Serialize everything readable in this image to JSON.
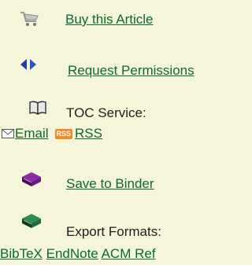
{
  "links": {
    "buy_article": "Buy this Article",
    "request_permissions": "Request Permissions",
    "save_to_binder": "Save to Binder"
  },
  "toc": {
    "heading": "TOC Service:",
    "email": "Email",
    "rss_badge": "RSS",
    "rss": "RSS"
  },
  "export": {
    "heading": "Export Formats:",
    "bibtex": "BibTeX",
    "endnote": "EndNote",
    "acm_ref": "ACM Ref"
  },
  "icons": {
    "buy": "cart-icon",
    "permissions": "permissions-arrows-icon",
    "toc": "open-book-icon",
    "email": "envelope-icon",
    "binder": "purple-book-icon",
    "export": "green-book-icon"
  },
  "colors": {
    "background": "#f5f5d9",
    "link": "#0b6b2b",
    "permissions_icon": "#1f3fa0",
    "binder_icon": "#6b1a80",
    "export_icon": "#1f6b3a",
    "rss_badge": "#f08a24"
  }
}
